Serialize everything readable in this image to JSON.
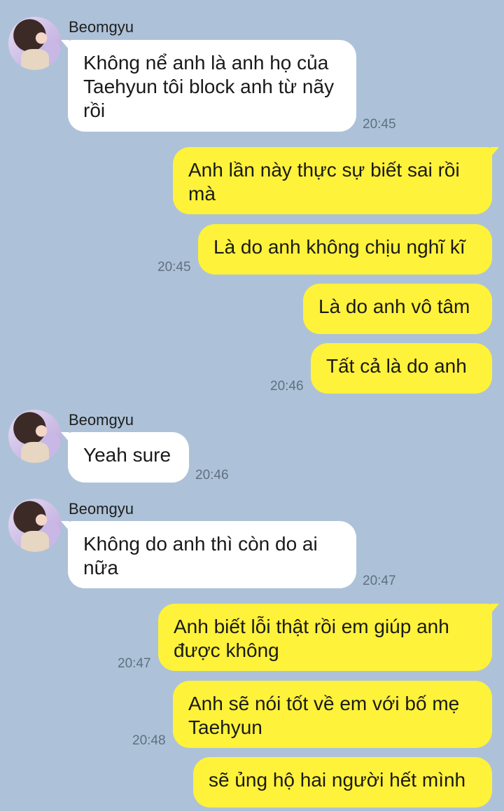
{
  "messages": [
    {
      "sender": "Beomgyu",
      "direction": "in",
      "text": "Không nể anh là anh họ của Taehyun tôi block anh từ nãy rồi",
      "time": "20:45"
    },
    {
      "direction": "out",
      "text": "Anh lần này thực sự biết sai rồi mà",
      "time": ""
    },
    {
      "direction": "out",
      "text": "Là do anh không chịu nghĩ kĩ",
      "time": "20:45"
    },
    {
      "direction": "out",
      "text": "Là do anh vô tâm",
      "time": ""
    },
    {
      "direction": "out",
      "text": "Tất cả là do anh",
      "time": "20:46"
    },
    {
      "sender": "Beomgyu",
      "direction": "in",
      "text": "Yeah sure",
      "time": "20:46"
    },
    {
      "sender": "Beomgyu",
      "direction": "in",
      "text": "Không do anh thì còn do ai nữa",
      "time": "20:47"
    },
    {
      "direction": "out",
      "text": "Anh biết lỗi thật rồi em giúp  anh được không",
      "time": "20:47"
    },
    {
      "direction": "out",
      "text": "Anh sẽ nói tốt về em với bố mẹ Taehyun",
      "time": "20:48"
    },
    {
      "direction": "out",
      "text": "sẽ ủng hộ hai người hết mình",
      "time": ""
    }
  ],
  "colors": {
    "background": "#adc2d8",
    "incoming_bubble": "#ffffff",
    "outgoing_bubble": "#fff23a",
    "timestamp": "#5f6f80"
  }
}
